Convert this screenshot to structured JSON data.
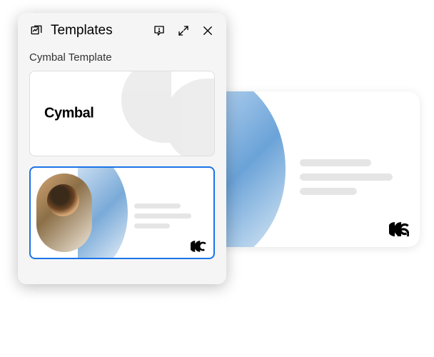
{
  "panel": {
    "title": "Templates",
    "section_label": "Cymbal Template"
  },
  "thumbnails": {
    "card1_brand": "Cymbal"
  },
  "icons": {
    "templates": "templates-icon",
    "feedback": "feedback-icon",
    "expand": "expand-icon",
    "close": "close-icon"
  }
}
